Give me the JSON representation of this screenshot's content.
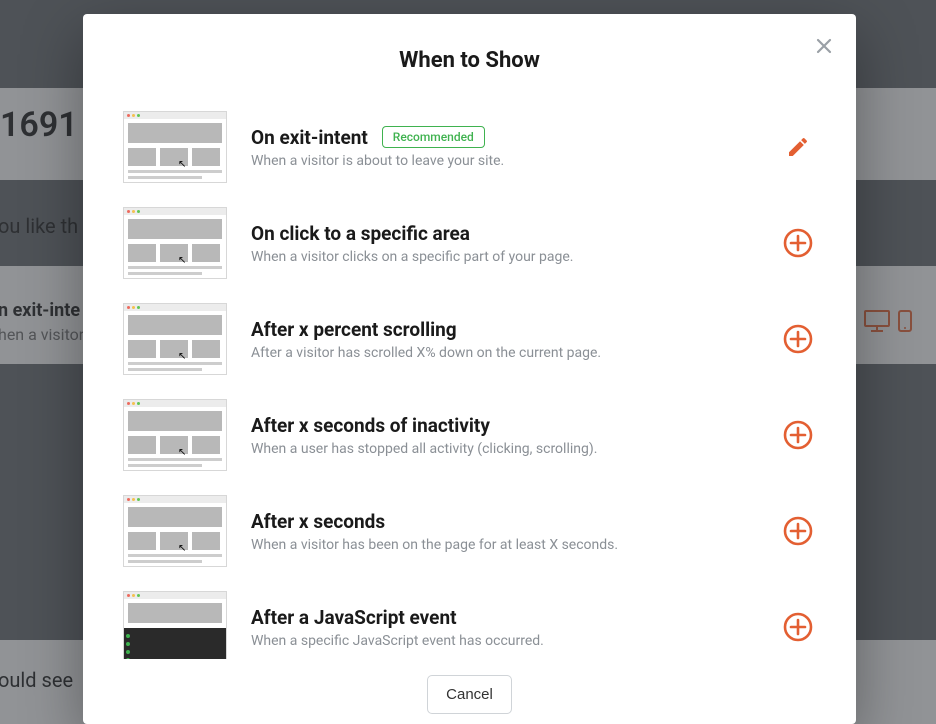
{
  "background": {
    "campaign_id": "1691",
    "question_text": "ou like th",
    "trigger_label": "n exit-inte",
    "trigger_desc": "hen a visitor is",
    "audience_text": "ould see"
  },
  "modal": {
    "title": "When to Show",
    "cancel_label": "Cancel",
    "badge_label": "Recommended"
  },
  "options": [
    {
      "key": "exit-intent",
      "title": "On exit-intent",
      "desc": "When a visitor is about to leave your site.",
      "recommended": true,
      "action": "edit"
    },
    {
      "key": "click-area",
      "title": "On click to a specific area",
      "desc": "When a visitor clicks on a specific part of your page.",
      "recommended": false,
      "action": "add"
    },
    {
      "key": "scroll",
      "title": "After x percent scrolling",
      "desc": "After a visitor has scrolled X% down on the current page.",
      "recommended": false,
      "action": "add"
    },
    {
      "key": "inactivity",
      "title": "After x seconds of inactivity",
      "desc": "When a user has stopped all activity (clicking, scrolling).",
      "recommended": false,
      "action": "add"
    },
    {
      "key": "seconds",
      "title": "After x seconds",
      "desc": "When a visitor has been on the page for at least X seconds.",
      "recommended": false,
      "action": "add"
    },
    {
      "key": "js-event",
      "title": "After a JavaScript event",
      "desc": "When a specific JavaScript event has occurred.",
      "recommended": false,
      "action": "add"
    }
  ],
  "colors": {
    "accent": "#e35f32",
    "success": "#3fb24f"
  }
}
